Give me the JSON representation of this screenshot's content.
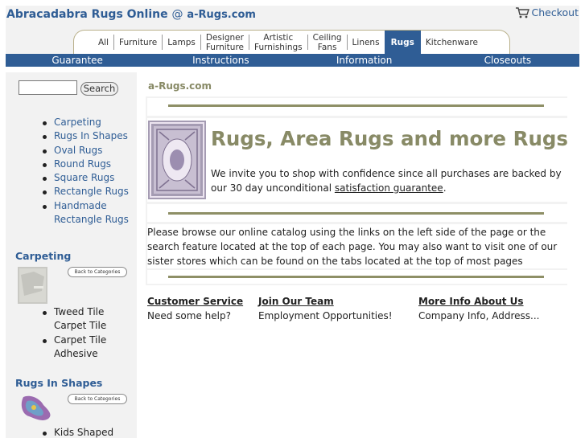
{
  "header": {
    "site_name": "Abracadabra Rugs Online",
    "at": "@",
    "domain": "a-Rugs.com",
    "checkout_label": "Checkout"
  },
  "tabs": [
    {
      "label": "All"
    },
    {
      "label": "Furniture"
    },
    {
      "label": "Lamps"
    },
    {
      "label": "Designer\nFurniture"
    },
    {
      "label": "Artistic\nFurnishings"
    },
    {
      "label": "Ceiling\nFans"
    },
    {
      "label": "Linens"
    },
    {
      "label": "Rugs",
      "active": true
    },
    {
      "label": "Kitchenware"
    }
  ],
  "nav": [
    "Guarantee",
    "Instructions",
    "Information",
    "Closeouts"
  ],
  "sidebar": {
    "search_button": "Search",
    "categories": [
      "Carpeting",
      "Rugs In Shapes",
      "Oval Rugs",
      "Round Rugs",
      "Square Rugs",
      "Rectangle Rugs",
      "Handmade Rectangle Rugs"
    ],
    "sections": [
      {
        "heading": "Carpeting",
        "back_label": "Back to Categories",
        "items": [
          "Tweed Tile Carpet Tile",
          "Carpet Tile Adhesive"
        ]
      },
      {
        "heading": "Rugs In Shapes",
        "back_label": "Back to Categories",
        "items": [
          "Kids Shaped"
        ]
      }
    ]
  },
  "main": {
    "breadcrumb": "a-Rugs.com",
    "hero_title": "Rugs, Area Rugs and more Rugs",
    "hero_text_before": "We invite you to shop with confidence since all purchases are backed by our 30 day unconditional ",
    "hero_link": "satisfaction guarantee",
    "hero_text_after": ".",
    "body_text": "Please browse our online catalog using the links on the left side of the page or the search feature located at the top of each page. You may also want to visit one of our sister stores which can be found on the tabs located at the top of most pages",
    "footer": [
      {
        "heading": "Customer Service",
        "sub": "Need some help?"
      },
      {
        "heading": "Join Our Team",
        "sub": "Employment Opportunities!"
      },
      {
        "heading": "More Info About Us",
        "sub": "Company Info, Address..."
      }
    ]
  },
  "colors": {
    "brand_blue": "#2f5d95",
    "olive": "#888a66",
    "panel_gray": "#f2f2f2"
  }
}
